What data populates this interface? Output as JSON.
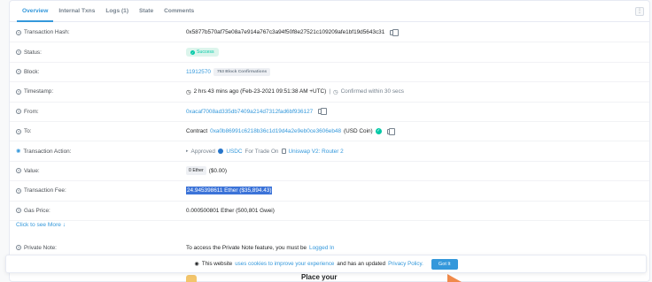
{
  "tabs": [
    "Overview",
    "Internal Txns",
    "Logs (1)",
    "State",
    "Comments"
  ],
  "more_icon": "⋮",
  "rows": {
    "tx_hash": {
      "label": "Transaction Hash:",
      "value": "0x5877b570af75e08a7e914a767c3a94f50f8e27521c109209afe1bf19d5643c31"
    },
    "status": {
      "label": "Status:",
      "value": "Success"
    },
    "block": {
      "label": "Block:",
      "value": "11912570",
      "confirmations": "753 Block Confirmations"
    },
    "timestamp": {
      "label": "Timestamp:",
      "value": "2 hrs 43 mins ago (Feb-23-2021 09:51:38 AM +UTC)",
      "separator": "|",
      "confirmed": "Confirmed within 30 secs"
    },
    "from": {
      "label": "From:",
      "value": "0xacaf7008ad335db7409a214d7312fad6bf936127"
    },
    "to": {
      "label": "To:",
      "prefix": "Contract",
      "value": "0xa0b86991c6218b36c1d19d4a2e9eb0ce3606eb48",
      "token": "(USD Coin)"
    },
    "action": {
      "label": "Transaction Action:",
      "approved": "Approved",
      "token": "USDC",
      "for_trade": "For Trade On",
      "dex": "Uniswap V2: Router 2"
    },
    "value": {
      "label": "Value:",
      "ether": "0 Ether",
      "usd": "($0.00)"
    },
    "fee": {
      "label": "Transaction Fee:",
      "value": "24.945398611 Ether ($35,894.43)"
    },
    "gas": {
      "label": "Gas Price:",
      "value": "0.000500801 Ether (500,801 Gwei)"
    },
    "note": {
      "label": "Private Note:",
      "text": "To access the Private Note feature, you must be",
      "link": "Logged In"
    }
  },
  "see_more": "Click to see More",
  "cookie": {
    "text1": "This website",
    "link1": "uses cookies to improve your experience",
    "text2": "and has an updated",
    "link2": "Privacy Policy.",
    "button": "Got It"
  },
  "promo": {
    "text": "Place your"
  },
  "colors": {
    "accent": "#3498db",
    "success": "#00c9a7",
    "highlight": "#3b73d8"
  }
}
